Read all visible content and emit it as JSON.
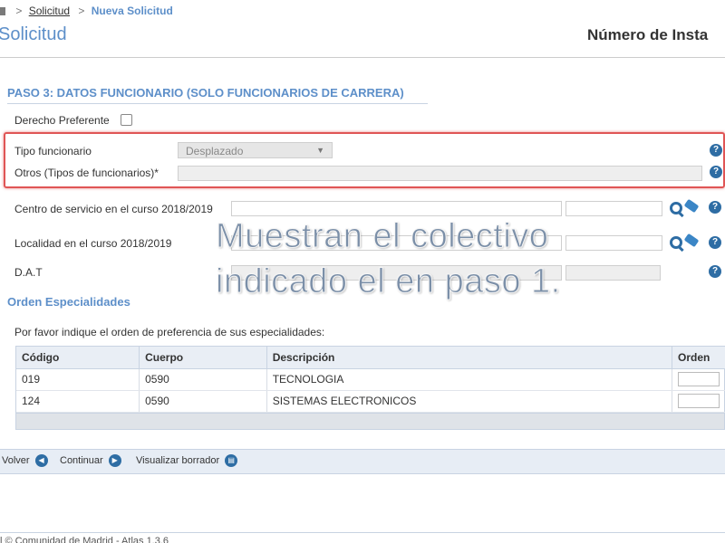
{
  "breadcrumb": {
    "items": [
      {
        "label": "Solicitud"
      },
      {
        "label": "Nueva Solicitud"
      }
    ],
    "separator": ">"
  },
  "header": {
    "title": "Solicitud",
    "numero_label": "Número de Insta"
  },
  "paso3": {
    "title": "PASO 3: DATOS FUNCIONARIO (SOLO FUNCIONARIOS DE CARRERA)",
    "derecho_preferente_label": "Derecho Preferente",
    "tipo_funcionario_label": "Tipo funcionario",
    "tipo_funcionario_value": "Desplazado",
    "otros_label": "Otros (Tipos de funcionarios)*",
    "centro_label": "Centro de servicio en el curso 2018/2019",
    "localidad_label": "Localidad en el curso 2018/2019",
    "dat_label": "D.A.T"
  },
  "caption": {
    "line1": "Muestran el colectivo",
    "line2": "indicado el en paso 1."
  },
  "orden": {
    "title": "Orden Especialidades",
    "intro": "Por favor indique el orden de preferencia de sus especialidades:",
    "columns": [
      "Código",
      "Cuerpo",
      "Descripción",
      "Orden"
    ],
    "rows": [
      {
        "codigo": "019",
        "cuerpo": "0590",
        "descripcion": "TECNOLOGIA",
        "orden": ""
      },
      {
        "codigo": "124",
        "cuerpo": "0590",
        "descripcion": "SISTEMAS ELECTRONICOS",
        "orden": ""
      }
    ]
  },
  "actions": {
    "volver": "Volver",
    "continuar": "Continuar",
    "visualizar": "Visualizar borrador"
  },
  "footer": {
    "text": "l © Comunidad de Madrid - Atlas 1.3.6"
  },
  "colors": {
    "accent": "#5d8fc9",
    "icon_blue": "#2e6da4",
    "highlight": "#e05555"
  }
}
